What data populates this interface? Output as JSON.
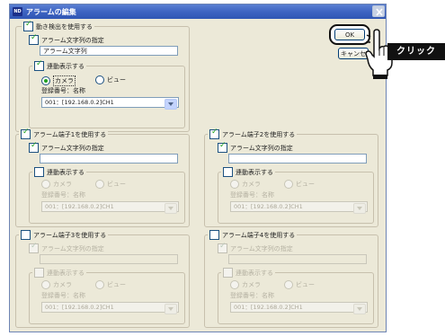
{
  "window": {
    "app_icon": "ND",
    "title": "アラームの編集",
    "close_icon": "close-icon"
  },
  "buttons": {
    "ok": "OK",
    "cancel_partial": "キャンセ"
  },
  "callout": {
    "label": "クリック",
    "hand_icon": "pointing-hand-icon"
  },
  "motion": {
    "label": "動き検出を使用する",
    "checked": true,
    "string_label": "アラーム文字列の指定",
    "string_value": "アラーム文字列",
    "linked_label": "連動表示する",
    "camera_label": "カメラ",
    "view_label": "ビュー",
    "reg_label": "登録番号：名称",
    "selected_camera": "001：[192.168.0.2]CH1"
  },
  "terminals": [
    {
      "label": "アラーム端子1を使用する",
      "checked": true,
      "enabled": true,
      "string_label": "アラーム文字列の指定",
      "string_value": "",
      "linked_label": "連動表示する",
      "camera_label": "カメラ",
      "view_label": "ビュー",
      "reg_label": "登録番号：名称",
      "selected_camera": "001：[192.168.0.2]CH1"
    },
    {
      "label": "アラーム端子2を使用する",
      "checked": true,
      "enabled": true,
      "string_label": "アラーム文字列の指定",
      "string_value": "",
      "linked_label": "連動表示する",
      "camera_label": "カメラ",
      "view_label": "ビュー",
      "reg_label": "登録番号：名称",
      "selected_camera": "001：[192.168.0.2]CH1"
    },
    {
      "label": "アラーム端子3を使用する",
      "checked": false,
      "enabled": false,
      "string_label": "アラーム文字列の指定",
      "string_value": "",
      "linked_label": "連動表示する",
      "camera_label": "カメラ",
      "view_label": "ビュー",
      "reg_label": "登録番号：名称",
      "selected_camera": "001：[192.168.0.2]CH1"
    },
    {
      "label": "アラーム端子4を使用する",
      "checked": false,
      "enabled": false,
      "string_label": "アラーム文字列の指定",
      "string_value": "",
      "linked_label": "連動表示する",
      "camera_label": "カメラ",
      "view_label": "ビュー",
      "reg_label": "登録番号：名称",
      "selected_camera": "001：[192.168.0.2]CH1"
    }
  ],
  "colors": {
    "title_bar": "#3e64c2",
    "dialog_bg": "#ece9d8",
    "check_mark": "#21a121",
    "callout_bg": "#111111"
  }
}
